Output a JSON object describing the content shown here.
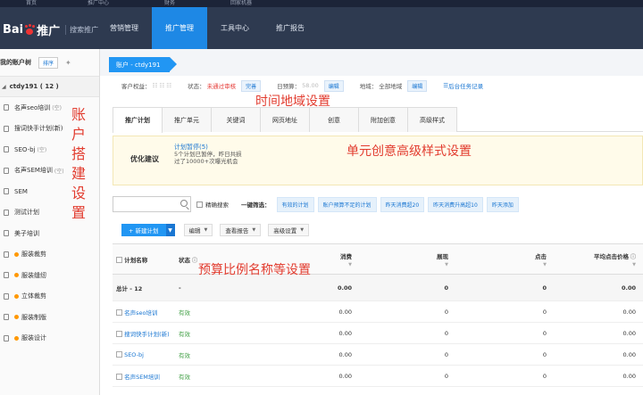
{
  "topbar": {
    "items": [
      "首页",
      "推广中心",
      "财务",
      "回家机器"
    ]
  },
  "header": {
    "logo_main": "Bai",
    "logo_tail": "推广",
    "logo_sub": "搜索推广",
    "nav": [
      "营销管理",
      "推广管理",
      "工具中心",
      "推广报告"
    ],
    "active_nav_index": 1,
    "accent": "#1e88e5",
    "bg": "#2e3a50"
  },
  "sidebar": {
    "title": "我的账户树",
    "sort_label": "排序",
    "pin_icon": "pin-icon",
    "account": "ctdy191 ( 12 )",
    "items": [
      {
        "label": "名声seo培训",
        "tag": "空"
      },
      {
        "label": "搜词快手计划(新)",
        "tag": ""
      },
      {
        "label": "SEO-bj",
        "tag": "空"
      },
      {
        "label": "名声SEM培训",
        "tag": "空"
      },
      {
        "label": "SEM",
        "tag": ""
      },
      {
        "label": "测试计划",
        "tag": ""
      },
      {
        "label": "美子培训",
        "tag": ""
      },
      {
        "label": "服装裁剪",
        "tag": ""
      },
      {
        "label": "服装缝纫",
        "tag": ""
      },
      {
        "label": "立体裁剪",
        "tag": ""
      },
      {
        "label": "服装制版",
        "tag": ""
      },
      {
        "label": "服装设计",
        "tag": ""
      }
    ]
  },
  "main": {
    "breadcrumb": "账户 - ctdy191",
    "info": {
      "rights_label": "客户权益：",
      "status_label": "状态：",
      "status_value": "未通过审核",
      "status_btn": "完善",
      "budget_label": "日预算：",
      "budget_value": "58.00",
      "budget_btn": "编辑",
      "region_label": "地域：",
      "region_value": "全部地域",
      "region_btn": "编辑",
      "task_link": "后台任务记录"
    },
    "tabs": [
      "推广计划",
      "推广单元",
      "关键词",
      "网页地址",
      "创意",
      "附加创意",
      "高级样式"
    ],
    "active_tab_index": 0,
    "suggest": {
      "title": "优化建议",
      "box_title": "计划暂停(5)",
      "line1": "5个计划已暂停，昨日共损",
      "line2": "过了10000+次曝光机会"
    },
    "filter": {
      "precise_label": "精确搜索",
      "quick_label": "一键筛选：",
      "pills": [
        "有效的计划",
        "账户预算不足的计划",
        "昨天消费超20",
        "昨天消费升高超10",
        "昨天添加"
      ]
    },
    "toolbar": {
      "new_plan": "+ 新建计划",
      "edit": "编辑",
      "report": "查看报告",
      "advanced": "高级设置"
    },
    "table": {
      "headers": [
        "计划名称",
        "状态",
        "消费",
        "展现",
        "点击",
        "平均点击价格"
      ],
      "total": {
        "name": "总计 - 12",
        "status": "-",
        "cost": "0.00",
        "impr": "0",
        "click": "0",
        "avg": "0.00"
      },
      "rows": [
        {
          "name": "名声seo培训",
          "status": "有效",
          "cost": "0.00",
          "impr": "0",
          "click": "0",
          "avg": "0.00"
        },
        {
          "name": "搜词快手计划(新)",
          "status": "有效",
          "cost": "0.00",
          "impr": "0",
          "click": "0",
          "avg": "0.00"
        },
        {
          "name": "SEO-bj",
          "status": "有效",
          "cost": "0.00",
          "impr": "0",
          "click": "0",
          "avg": "0.00"
        },
        {
          "name": "名声SEM培训",
          "status": "有效",
          "cost": "0.00",
          "impr": "0",
          "click": "0",
          "avg": "0.00"
        }
      ]
    }
  },
  "annotations": {
    "account_setup": "账户搭建设置",
    "time_region": "时间地域设置",
    "unit_creative": "单元创意高级样式设置",
    "budget_ratio": "预算比例名称等设置"
  }
}
